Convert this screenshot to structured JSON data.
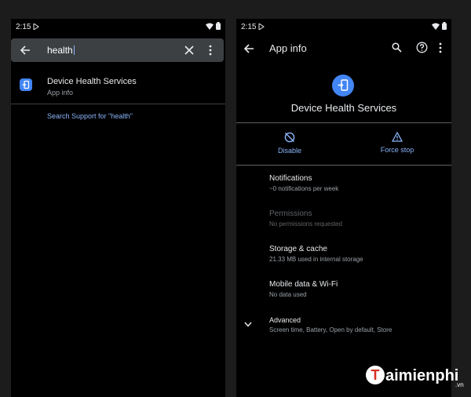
{
  "left_screen": {
    "status": {
      "time": "2:15"
    },
    "search": {
      "query": "health"
    },
    "result": {
      "title": "Device Health Services",
      "subtitle": "App info"
    },
    "search_support": "Search Support for \"health\""
  },
  "right_screen": {
    "status": {
      "time": "2:15"
    },
    "appbar": {
      "title": "App info"
    },
    "app_name": "Device Health Services",
    "actions": {
      "disable": "Disable",
      "force_stop": "Force stop"
    },
    "preferences": [
      {
        "title": "Notifications",
        "summary": "~0 notifications per week",
        "enabled": true
      },
      {
        "title": "Permissions",
        "summary": "No permissions requested",
        "enabled": false
      },
      {
        "title": "Storage & cache",
        "summary": "21.33 MB used in internal storage",
        "enabled": true
      },
      {
        "title": "Mobile data & Wi-Fi",
        "summary": "No data used",
        "enabled": true
      },
      {
        "title": "Advanced",
        "summary": "Screen time, Battery, Open by default, Store",
        "enabled": true
      }
    ]
  },
  "watermark": {
    "letter": "T",
    "brand": "aimienphi",
    "suffix": ".vn"
  },
  "icons": {
    "back": "arrow-back-icon",
    "clear": "close-icon",
    "more": "more-vert-icon",
    "search": "search-icon",
    "help": "help-icon",
    "app": "device-health-app-icon",
    "disable": "disable-icon",
    "force_stop": "warning-triangle-icon",
    "expand": "chevron-down-icon",
    "wifi": "wifi-icon",
    "battery": "battery-icon",
    "play": "play-store-icon"
  },
  "colors": {
    "accent": "#8ab4f8",
    "app_icon": "#4285f4",
    "background": "#000000",
    "search_field": "#3c4043"
  }
}
